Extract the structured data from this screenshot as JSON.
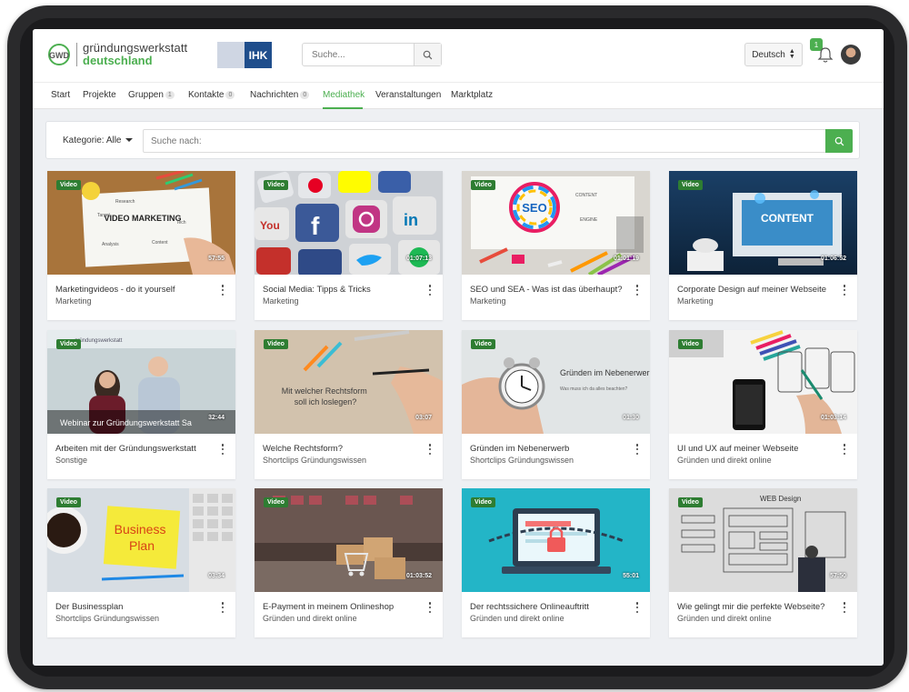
{
  "header": {
    "logo_line1": "gründungswerkstatt",
    "logo_line2": "deutschland",
    "ihk": "IHK",
    "search_placeholder": "Suche...",
    "language": "Deutsch",
    "notifications_count": "1"
  },
  "nav": {
    "items": [
      {
        "label": "Start"
      },
      {
        "label": "Projekte"
      },
      {
        "label": "Gruppen",
        "count": "1"
      },
      {
        "label": "Kontakte",
        "count": "0"
      },
      {
        "label": "Nachrichten",
        "count": "0"
      },
      {
        "label": "Mediathek"
      },
      {
        "label": "Veranstaltungen"
      },
      {
        "label": "Marktplatz"
      }
    ],
    "active": "Mediathek"
  },
  "filter": {
    "category_label": "Kategorie: Alle",
    "search_placeholder": "Suche nach:"
  },
  "cards": [
    {
      "badge": "Video",
      "duration": "57:55",
      "title": "Marketingvideos - do it yourself",
      "category": "Marketing",
      "thumb_text": "VIDEO MARKETING"
    },
    {
      "badge": "Video",
      "duration": "01:07:13",
      "title": "Social Media: Tipps & Tricks",
      "category": "Marketing"
    },
    {
      "badge": "Video",
      "duration": "01:01:19",
      "title": "SEO und SEA - Was ist das überhaupt?",
      "category": "Marketing",
      "thumb_text": "SEO"
    },
    {
      "badge": "Video",
      "duration": "01:06:52",
      "title": "Corporate Design auf meiner Webseite",
      "category": "Marketing",
      "thumb_text": "CONTENT"
    },
    {
      "badge": "Video",
      "duration": "32:44",
      "title": "Arbeiten mit der Gründungswerkstatt",
      "category": "Sonstige",
      "thumb_text": "Webinar zur Gründungswerkstatt Sa"
    },
    {
      "badge": "Video",
      "duration": "03:07",
      "title": "Welche Rechtsform?",
      "category": "Shortclips Gründungswissen",
      "thumb_text": "Mit welcher Rechtsform soll ich loslegen?"
    },
    {
      "badge": "Video",
      "duration": "01:30",
      "title": "Gründen im Nebenerwerb",
      "category": "Shortclips Gründungswissen",
      "thumb_text": "Gründen im Nebenerwerb",
      "thumb_sub": "Was muss ich da alles beachten?"
    },
    {
      "badge": "Video",
      "duration": "01:03:14",
      "title": "UI und UX auf meiner Webseite",
      "category": "Gründen und direkt online"
    },
    {
      "badge": "Video",
      "duration": "03:34",
      "title": "Der Businessplan",
      "category": "Shortclips Gründungswissen",
      "thumb_text": "Business Plan"
    },
    {
      "badge": "Video",
      "duration": "01:03:52",
      "title": "E-Payment in meinem Onlineshop",
      "category": "Gründen und direkt online"
    },
    {
      "badge": "Video",
      "duration": "55:01",
      "title": "Der rechtssichere Onlineauftritt",
      "category": "Gründen und direkt online"
    },
    {
      "badge": "Video",
      "duration": "57:50",
      "title": "Wie gelingt mir die perfekte Webseite?",
      "category": "Gründen und direkt online",
      "thumb_text": "WEB Design"
    }
  ],
  "colors": {
    "accent": "#4caf50",
    "badge": "#2e7d32",
    "background": "#eef0f3"
  }
}
